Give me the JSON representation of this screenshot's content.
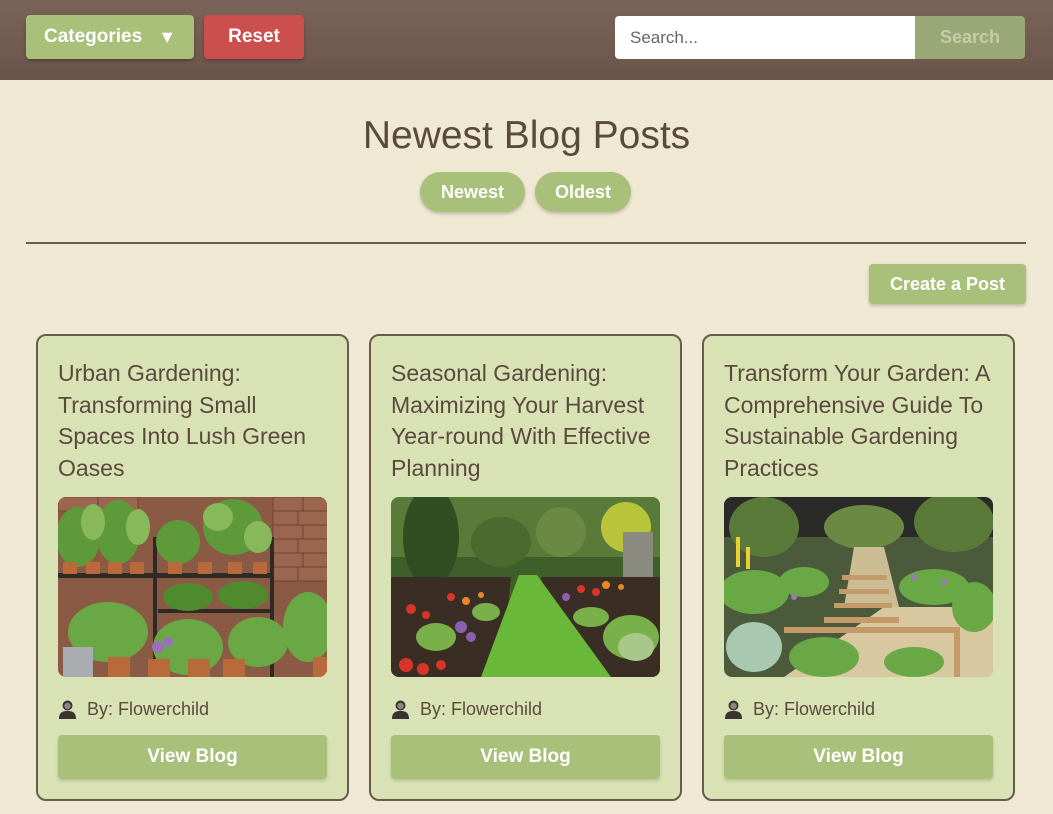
{
  "header": {
    "categories_label": "Categories",
    "categories_arrow": "▼",
    "reset_label": "Reset",
    "search_placeholder": "Search...",
    "search_label": "Search"
  },
  "main": {
    "title": "Newest Blog Posts",
    "sort_newest": "Newest",
    "sort_oldest": "Oldest",
    "create_label": "Create a Post"
  },
  "posts": [
    {
      "title": "Urban Gardening: Transforming Small Spaces Into Lush Green Oases",
      "author": "By: Flowerchild",
      "view_label": "View Blog",
      "image": "urban-vertical-garden"
    },
    {
      "title": "Seasonal Gardening: Maximizing Your Harvest Year-round With Effective Planning",
      "author": "By: Flowerchild",
      "view_label": "View Blog",
      "image": "garden-path-flowers"
    },
    {
      "title": "Transform Your Garden: A Comprehensive Guide To Sustainable Gardening Practices",
      "author": "By: Flowerchild",
      "view_label": "View Blog",
      "image": "terraced-garden-steps"
    }
  ],
  "colors": {
    "header_bg": "#6b554b",
    "page_bg": "#efe8d2",
    "accent_green": "#a9c07a",
    "reset_red": "#cb4f4c",
    "card_bg": "#d8e2b4",
    "text_brown": "#5a4a3e"
  }
}
